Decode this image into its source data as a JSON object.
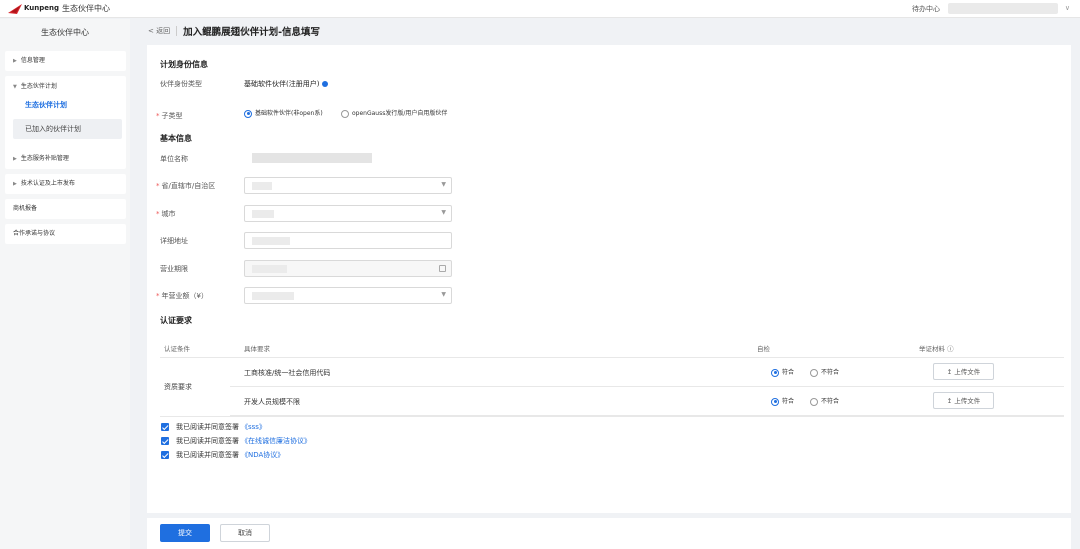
{
  "topbar": {
    "brand": "Kunpeng",
    "app_name": "生态伙伴中心",
    "todo": "待办中心",
    "arrow": "∨"
  },
  "sidebar": {
    "title": "生态伙伴中心",
    "items": [
      {
        "label": "信息管理"
      },
      {
        "label": "生态伙伴计划"
      },
      {
        "label": "生态服务补贴管理"
      },
      {
        "label": "技术认证及上市发布"
      },
      {
        "label": "商机报备"
      },
      {
        "label": "合作承诺与协议"
      }
    ],
    "sub_items": [
      {
        "label": "生态伙伴计划"
      },
      {
        "label": "已加入的伙伴计划"
      }
    ]
  },
  "breadcrumb": {
    "back": "< 返回",
    "title": "加入鲲鹏展翅伙伴计划-信息填写"
  },
  "form": {
    "section_plan": "计划身份信息",
    "partner_type_label": "伙伴身份类型",
    "partner_type_value": "基础软件伙伴(注册用户)",
    "subtype_label": "子类型",
    "subtype_options": [
      "基础软件伙伴(非open系)",
      "openGauss发行版/用户自用版伙伴"
    ],
    "section_basic": "基本信息",
    "company_label": "单位名称",
    "province_label": "省/直辖市/自治区",
    "city_label": "城市",
    "address_label": "详细地址",
    "term_label": "营业期限",
    "revenue_label": "年营业额（¥）",
    "section_cert": "认证要求"
  },
  "table": {
    "headers": [
      "认证条件",
      "具体要求",
      "自检",
      "举证材料 ⓘ"
    ],
    "group": "资质要求",
    "rows": [
      {
        "requirement": "工商核准/统一社会信用代码",
        "yes": "符合",
        "no": "不符合",
        "upload": "上传文件"
      },
      {
        "requirement": "开发人员规模不限",
        "yes": "符合",
        "no": "不符合",
        "upload": "上传文件"
      }
    ]
  },
  "agreements": [
    {
      "prefix": "我已阅读并同意签署",
      "link": "《sss》"
    },
    {
      "prefix": "我已阅读并同意签署",
      "link": "《在线诚信廉洁协议》"
    },
    {
      "prefix": "我已阅读并同意签署",
      "link": "《NDA协议》"
    }
  ],
  "footer": {
    "submit": "提交",
    "cancel": "取消"
  },
  "colors": {
    "primary": "#1f6fe0",
    "required": "#e55555"
  }
}
